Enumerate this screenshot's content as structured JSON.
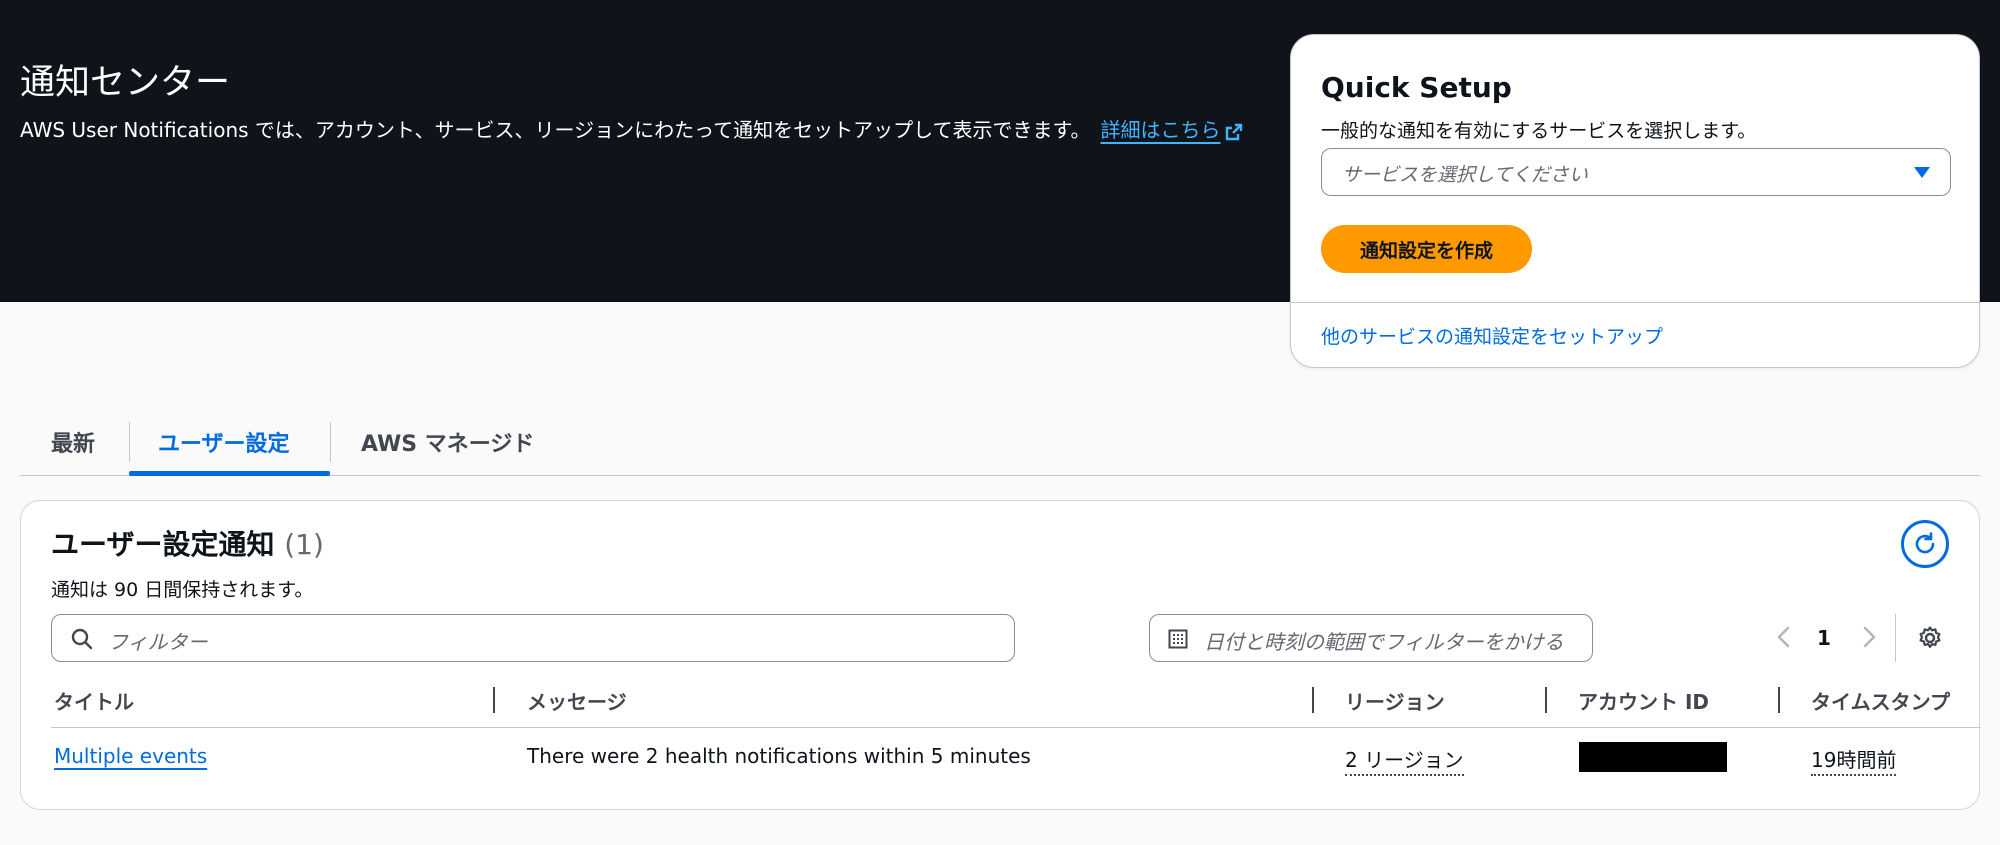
{
  "hero": {
    "title": "通知センター",
    "description": "AWS User Notifications では、アカウント、サービス、リージョンにわたって通知をセットアップして表示できます。",
    "link_label": "詳細はこちら"
  },
  "quick_setup": {
    "title": "Quick Setup",
    "description": "一般的な通知を有効にするサービスを選択します。",
    "select_placeholder": "サービスを選択してください",
    "create_button": "通知設定を作成",
    "other_link": "他のサービスの通知設定をセットアップ"
  },
  "tabs": [
    {
      "label": "最新",
      "active": false
    },
    {
      "label": "ユーザー設定",
      "active": true
    },
    {
      "label": "AWS マネージド",
      "active": false
    }
  ],
  "panel": {
    "title": "ユーザー設定通知",
    "count": "(1)",
    "subtitle": "通知は 90 日間保持されます。",
    "filter_placeholder": "フィルター",
    "date_filter_placeholder": "日付と時刻の範囲でフィルターをかける",
    "page": "1"
  },
  "table": {
    "columns": [
      "タイトル",
      "メッセージ",
      "リージョン",
      "アカウント ID",
      "タイムスタンプ"
    ],
    "rows": [
      {
        "title": "Multiple events",
        "message": "There were 2 health notifications within 5 minutes",
        "region": "2 リージョン",
        "account_id": "",
        "timestamp": "19時間前"
      }
    ]
  },
  "colors": {
    "hero_bg": "#0f141a",
    "link": "#006ce0",
    "primary_button": "#ff9900"
  }
}
